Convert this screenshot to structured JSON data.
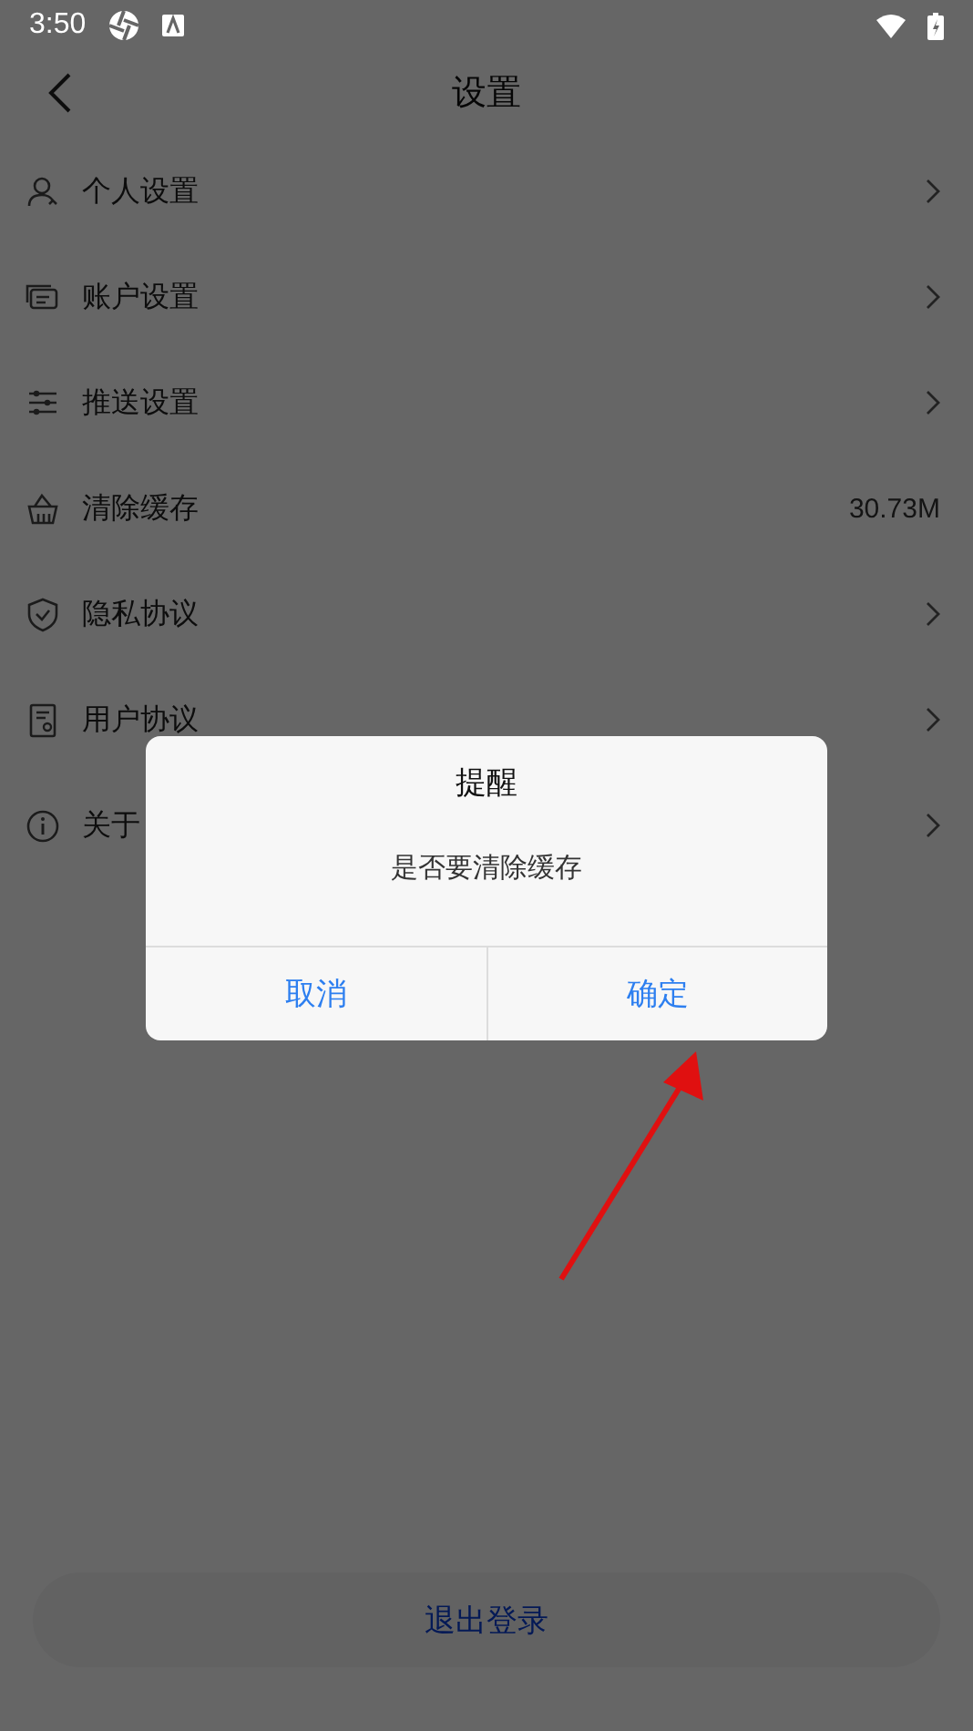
{
  "status_bar": {
    "time": "3:50"
  },
  "header": {
    "title": "设置"
  },
  "items": [
    {
      "label": "个人设置",
      "kind": "link"
    },
    {
      "label": "账户设置",
      "kind": "link"
    },
    {
      "label": "推送设置",
      "kind": "link"
    },
    {
      "label": "清除缓存",
      "kind": "value",
      "value": "30.73M"
    },
    {
      "label": "隐私协议",
      "kind": "link"
    },
    {
      "label": "用户协议",
      "kind": "link"
    },
    {
      "label": "关于",
      "kind": "link"
    }
  ],
  "logout": {
    "label": "退出登录"
  },
  "dialog": {
    "title": "提醒",
    "message": "是否要清除缓存",
    "buttons": [
      {
        "label": "取消"
      },
      {
        "label": "确定"
      }
    ]
  }
}
